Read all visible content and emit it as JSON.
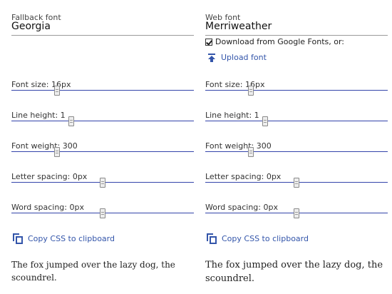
{
  "left": {
    "font_label": "Fallback font",
    "font_value": "Georgia",
    "sliders": [
      {
        "label": "Font size: 16px",
        "fraction": 0.25
      },
      {
        "label": "Line height: 1",
        "fraction": 0.33
      },
      {
        "label": "Font weight: 300",
        "fraction": 0.25
      },
      {
        "label": "Letter spacing: 0px",
        "fraction": 0.5
      },
      {
        "label": "Word spacing: 0px",
        "fraction": 0.5
      }
    ],
    "copy_label": "Copy CSS to clipboard",
    "sample_text": "The fox jumped over the lazy dog, the scoundrel."
  },
  "right": {
    "font_label": "Web font",
    "font_value": "Merriweather",
    "download_label": "Download from Google Fonts, or:",
    "download_checked": true,
    "upload_label": "Upload font",
    "sliders": [
      {
        "label": "Font size: 16px",
        "fraction": 0.25
      },
      {
        "label": "Line height: 1",
        "fraction": 0.33
      },
      {
        "label": "Font weight: 300",
        "fraction": 0.25
      },
      {
        "label": "Letter spacing: 0px",
        "fraction": 0.5
      },
      {
        "label": "Word spacing: 0px",
        "fraction": 0.5
      }
    ],
    "copy_label": "Copy CSS to clipboard",
    "sample_text": "The fox jumped over the lazy dog, the scoundrel."
  },
  "colors": {
    "accent": "#3355aa",
    "track": "#3344aa"
  },
  "icons": {
    "upload": "upload-icon",
    "copy": "copy-icon",
    "checkbox": "checkbox-checked"
  }
}
